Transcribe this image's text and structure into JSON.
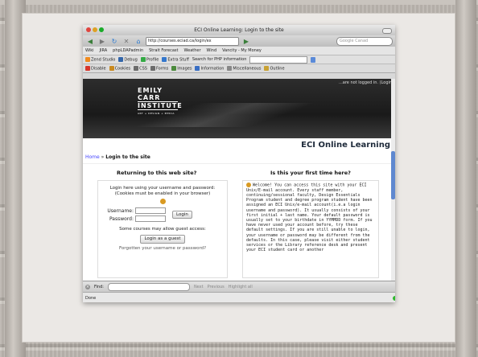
{
  "window": {
    "title": "ECI Online Learning: Login to the site"
  },
  "nav": {
    "url": "http://courses.eciad.ca/login/ex",
    "search_placeholder": "Google Canad"
  },
  "bookmarks": [
    "Wiki",
    "JIRA",
    "phpLDAPadmin",
    "Strait Forecast",
    "Weather",
    "Wind",
    "Vancity - My Money"
  ],
  "toolbar2": {
    "zend": "Zend Studio",
    "debug": "Debug",
    "profile": "Profile",
    "extra": "Extra Stuff",
    "search": "Search for PHP information"
  },
  "toolbar3": {
    "items": [
      "Disable",
      "Cookies",
      "CSS",
      "Forms",
      "Images",
      "Information",
      "Miscellaneous",
      "Outline"
    ]
  },
  "banner": {
    "logo_line1": "EMILY CARR",
    "logo_line2": "INSTITUTE",
    "logo_sub": "ART + DESIGN + MEDIA",
    "logged_in": "...are not logged in. (Login)"
  },
  "site": {
    "name": "ECI Online Learning"
  },
  "breadcrumb": {
    "home": "Home",
    "sep": "»",
    "current": "Login to the site"
  },
  "login": {
    "heading": "Returning to this web site?",
    "intro": "Login here using your username and password:",
    "cookies": "(Cookies must be enabled in your browser)",
    "username_label": "Username:",
    "password_label": "Password:",
    "login_button": "Login",
    "guest_note": "Some courses may allow guest access:",
    "guest_button": "Login as a guest",
    "forgot": "Forgotten your username or password?"
  },
  "info": {
    "heading": "Is this your first time here?",
    "body": "Welcome! You can access this site with your ECI Unix/E-mail account. Every staff member, continuing/sessional faculty, Design Essentials Program student and degree program student have been assigned an ECI Unix/e-mail account(i.e.a login username and password). It usually consists of your first initial + last name. Your default password is usually set to your birthdate in YYMMDD form. If you have never used your account before, try these default settings. If you are still unable to login, your username or password may be different from the defaults. In this case, please visit either student services or the Library reference desk and present your ECI student card or another"
  },
  "findbar": {
    "label": "Find:",
    "next": "Next",
    "previous": "Previous",
    "highlight": "Highlight all"
  },
  "status": {
    "text": "Done"
  }
}
